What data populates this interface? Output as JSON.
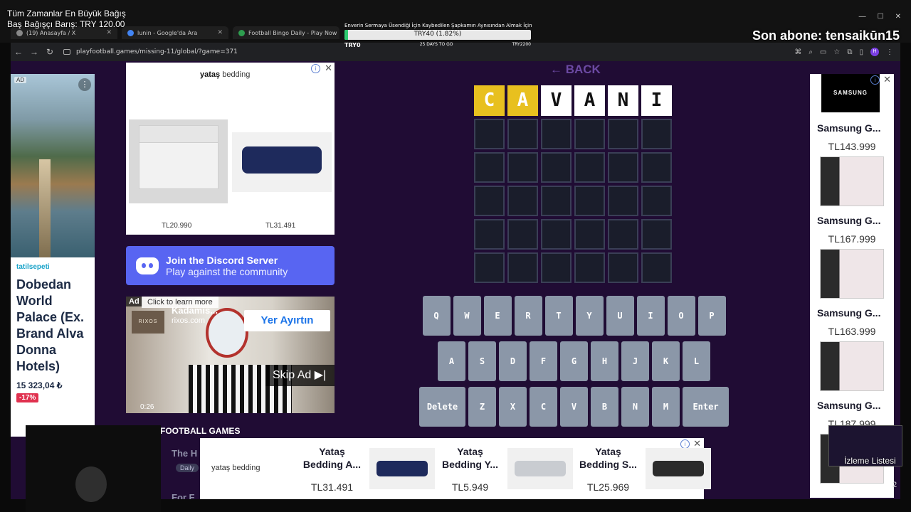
{
  "stream_overlay": {
    "donor_title": "Tüm Zamanlar En Büyük Bağış",
    "donor_line": "Baş Bağışçı Barış: TRY 120.00",
    "latest_sub": "Son abone: tensaikūn15",
    "goal": {
      "title": "Enverin Sermaya Üsendiği İçin Kaybedilen Şapkamın Aynısından Almak İçin",
      "progress_label": "TRY40 (1.82%)",
      "progress_fraction": 0.0182,
      "start": "TRY0",
      "days_left": "25 DAYS TO GO",
      "target": "TRY2200"
    },
    "pip_label": "İzleme Listesi",
    "pip_num": "2"
  },
  "browser": {
    "tabs": [
      {
        "label": "(19) Anasayfa / X"
      },
      {
        "label": "lunin - Google'da Ara"
      },
      {
        "label": "Football Bingo Daily - Play Now"
      }
    ],
    "url": "playfootball.games/missing-11/global/?game=371",
    "colors": {
      "bg": "#121212",
      "addr": "#202124"
    }
  },
  "left_ad": {
    "ad_badge": "AD",
    "brand": "tatilsepeti",
    "headline": "Dobedan World Palace (Ex. Brand Alva Donna Hotels)",
    "price": "15 323,04 ₺",
    "discount": "-17%"
  },
  "bed_ad": {
    "logo": "yataş",
    "logo_suffix": "bedding",
    "price_1": "TL20.990",
    "price_2": "TL31.491"
  },
  "discord": {
    "title": "Join the Discord Server",
    "subtitle": "Play against the community",
    "color": "#5865f2"
  },
  "video_ad": {
    "ad_tag": "Ad",
    "click_text": "Click to learn more",
    "title": "Kadamis...",
    "domain": "rixos.com",
    "logo_text": "RIXOS",
    "cta": "Yer Ayırtın",
    "skip": "Skip Ad ▶|",
    "time": "0:26"
  },
  "section": {
    "football_games": "FOOTBALL GAMES",
    "faded_1": "The H",
    "faded_2": "Daily",
    "faded_3": "For F"
  },
  "game": {
    "back": "← BACK",
    "rows": [
      [
        {
          "l": "C",
          "s": "yellow"
        },
        {
          "l": "A",
          "s": "yellow"
        },
        {
          "l": "V",
          "s": "white"
        },
        {
          "l": "A",
          "s": "white"
        },
        {
          "l": "N",
          "s": "white"
        },
        {
          "l": "I",
          "s": "white"
        }
      ],
      [
        {
          "l": "",
          "s": "empty"
        },
        {
          "l": "",
          "s": "empty"
        },
        {
          "l": "",
          "s": "empty"
        },
        {
          "l": "",
          "s": "empty"
        },
        {
          "l": "",
          "s": "empty"
        },
        {
          "l": "",
          "s": "empty"
        }
      ],
      [
        {
          "l": "",
          "s": "empty"
        },
        {
          "l": "",
          "s": "empty"
        },
        {
          "l": "",
          "s": "empty"
        },
        {
          "l": "",
          "s": "empty"
        },
        {
          "l": "",
          "s": "empty"
        },
        {
          "l": "",
          "s": "empty"
        }
      ],
      [
        {
          "l": "",
          "s": "empty"
        },
        {
          "l": "",
          "s": "empty"
        },
        {
          "l": "",
          "s": "empty"
        },
        {
          "l": "",
          "s": "empty"
        },
        {
          "l": "",
          "s": "empty"
        },
        {
          "l": "",
          "s": "empty"
        }
      ],
      [
        {
          "l": "",
          "s": "empty"
        },
        {
          "l": "",
          "s": "empty"
        },
        {
          "l": "",
          "s": "empty"
        },
        {
          "l": "",
          "s": "empty"
        },
        {
          "l": "",
          "s": "empty"
        },
        {
          "l": "",
          "s": "empty"
        }
      ],
      [
        {
          "l": "",
          "s": "empty"
        },
        {
          "l": "",
          "s": "empty"
        },
        {
          "l": "",
          "s": "empty"
        },
        {
          "l": "",
          "s": "empty"
        },
        {
          "l": "",
          "s": "empty"
        },
        {
          "l": "",
          "s": "empty"
        }
      ]
    ],
    "keyboard": [
      [
        "Q",
        "W",
        "E",
        "R",
        "T",
        "Y",
        "U",
        "I",
        "O",
        "P"
      ],
      [
        "A",
        "S",
        "D",
        "F",
        "G",
        "H",
        "J",
        "K",
        "L"
      ],
      [
        "Delete",
        "Z",
        "X",
        "C",
        "V",
        "B",
        "N",
        "M",
        "Enter"
      ]
    ],
    "colors": {
      "bg": "#200c34",
      "yellow": "#e8c01f",
      "key": "#8b97a8"
    }
  },
  "right_ad": {
    "logo": "SAMSUNG",
    "products": [
      {
        "name": "Samsung G...",
        "price": "TL143.999"
      },
      {
        "name": "Samsung G...",
        "price": "TL167.999"
      },
      {
        "name": "Samsung G...",
        "price": "TL163.999"
      },
      {
        "name": "Samsung G...",
        "price": "TL187.999"
      }
    ]
  },
  "bottom_ad": {
    "logo": "yataş bedding",
    "items": [
      {
        "name": "Yataş Bedding A...",
        "price": "TL31.491"
      },
      {
        "name": "Yataş Bedding Y...",
        "price": "TL5.949"
      },
      {
        "name": "Yataş Bedding S...",
        "price": "TL25.969"
      }
    ]
  }
}
